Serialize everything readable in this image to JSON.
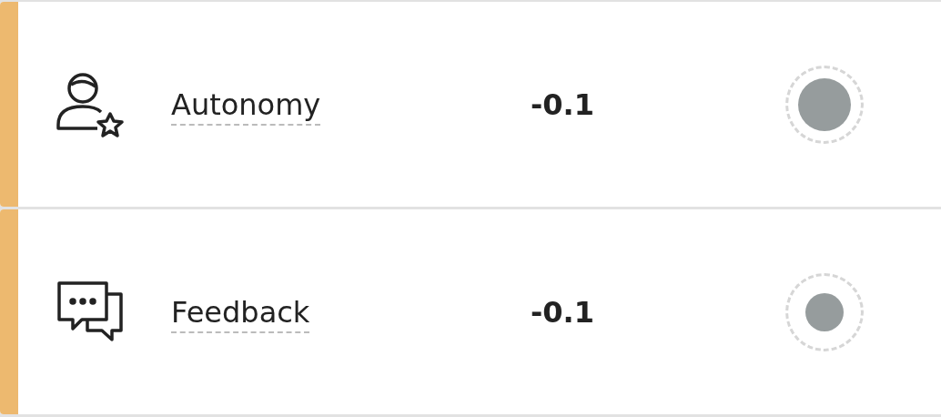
{
  "factors": [
    {
      "kind": "autonomy",
      "label": "Autonomy",
      "value": "-0.1"
    },
    {
      "kind": "feedback",
      "label": "Feedback",
      "value": "-0.1"
    }
  ]
}
